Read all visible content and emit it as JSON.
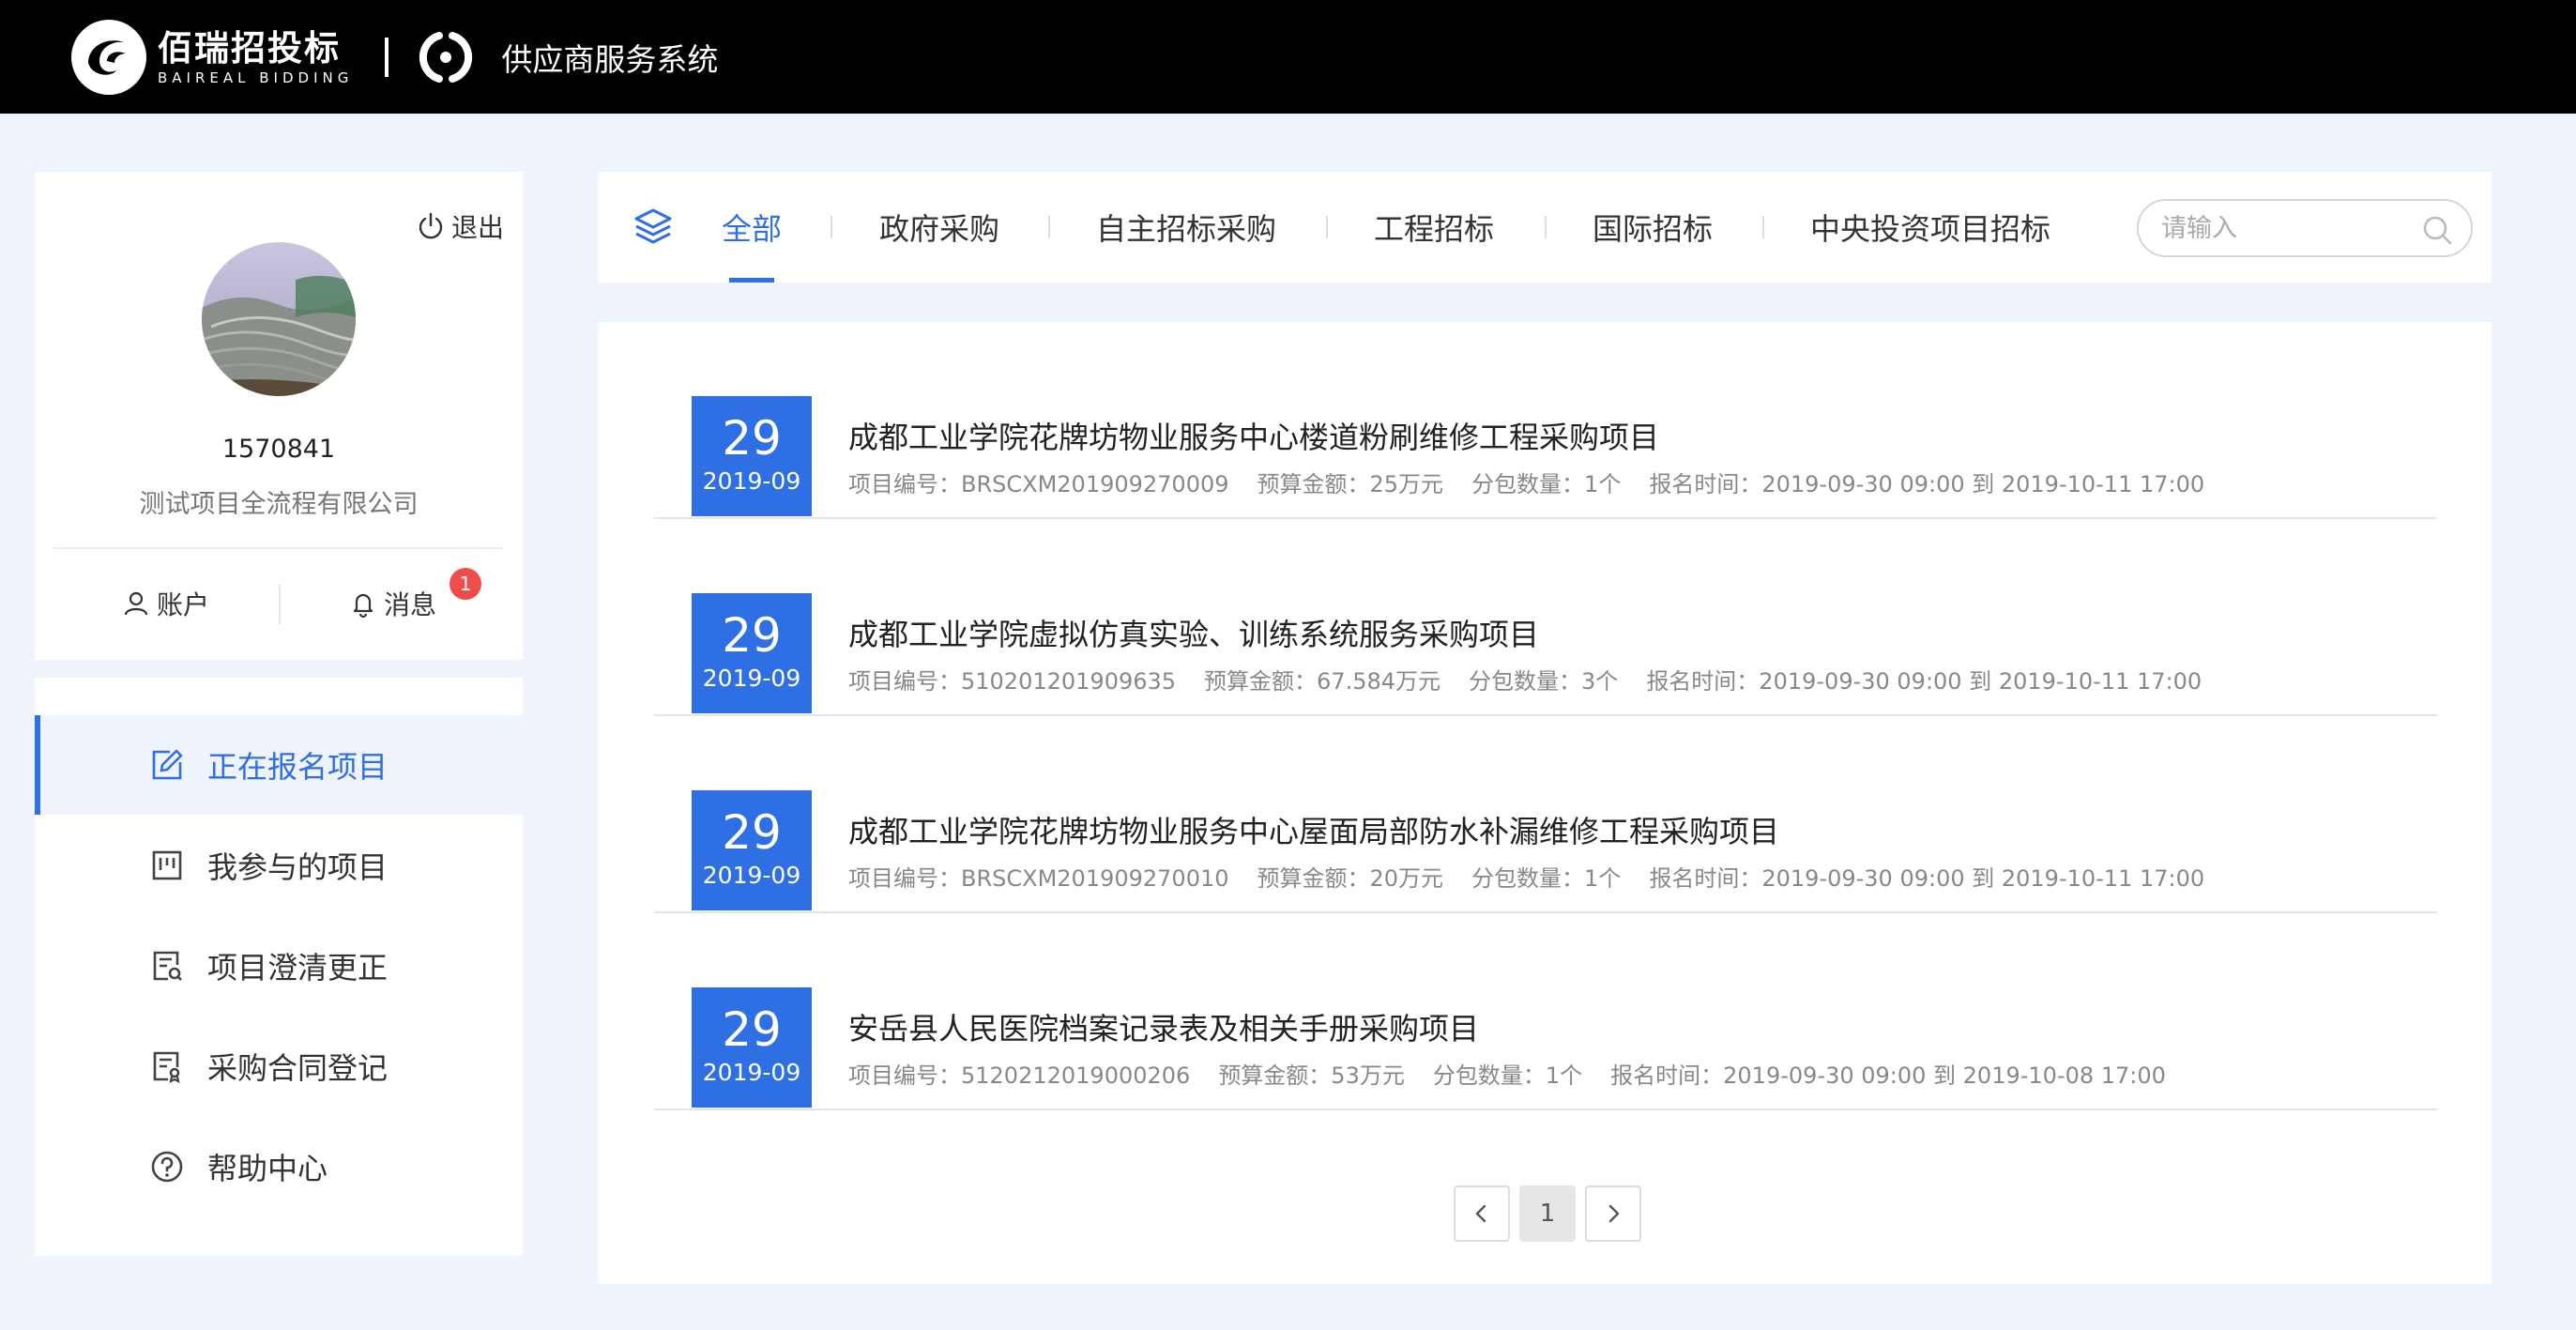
{
  "header": {
    "brand_cn": "佰瑞招投标",
    "brand_en": "BAIREAL BIDDING",
    "system_name": "供应商服务系统"
  },
  "profile": {
    "logout_label": "退出",
    "user_id": "1570841",
    "company": "测试项目全流程有限公司",
    "account_label": "账户",
    "message_label": "消息",
    "message_count": "1"
  },
  "menu": [
    {
      "label": "正在报名项目",
      "icon": "edit-icon",
      "active": true
    },
    {
      "label": "我参与的项目",
      "icon": "board-icon",
      "active": false
    },
    {
      "label": "项目澄清更正",
      "icon": "document-search-icon",
      "active": false
    },
    {
      "label": "采购合同登记",
      "icon": "contract-icon",
      "active": false
    },
    {
      "label": "帮助中心",
      "icon": "help-icon",
      "active": false
    }
  ],
  "tabs": [
    "全部",
    "政府采购",
    "自主招标采购",
    "工程招标",
    "国际招标",
    "中央投资项目招标"
  ],
  "search": {
    "placeholder": "请输入"
  },
  "projects": [
    {
      "day": "29",
      "ym": "2019-09",
      "title": "成都工业学院花牌坊物业服务中心楼道粉刷维修工程采购项目",
      "code": "项目编号：BRSCXM201909270009",
      "budget": "预算金额：25万元",
      "lots": "分包数量：1个",
      "reg_time": "报名时间：2019-09-30  09:00 到 2019-10-11  17:00"
    },
    {
      "day": "29",
      "ym": "2019-09",
      "title": "成都工业学院虚拟仿真实验、训练系统服务采购项目",
      "code": "项目编号：510201201909635",
      "budget": "预算金额：67.584万元",
      "lots": "分包数量：3个",
      "reg_time": "报名时间：2019-09-30  09:00 到 2019-10-11  17:00"
    },
    {
      "day": "29",
      "ym": "2019-09",
      "title": "成都工业学院花牌坊物业服务中心屋面局部防水补漏维修工程采购项目",
      "code": "项目编号：BRSCXM201909270010",
      "budget": "预算金额：20万元",
      "lots": "分包数量：1个",
      "reg_time": "报名时间：2019-09-30  09:00 到 2019-10-11  17:00"
    },
    {
      "day": "29",
      "ym": "2019-09",
      "title": "安岳县人民医院档案记录表及相关手册采购项目",
      "code": "项目编号：5120212019000206",
      "budget": "预算金额：53万元",
      "lots": "分包数量：1个",
      "reg_time": "报名时间：2019-09-30  09:00 到 2019-10-08  17:00"
    }
  ],
  "pagination": {
    "current": "1"
  },
  "colors": {
    "accent": "#2f6fe4",
    "header_bg": "#000000",
    "page_bg": "#eff3fb",
    "badge": "#ef4c4c"
  }
}
